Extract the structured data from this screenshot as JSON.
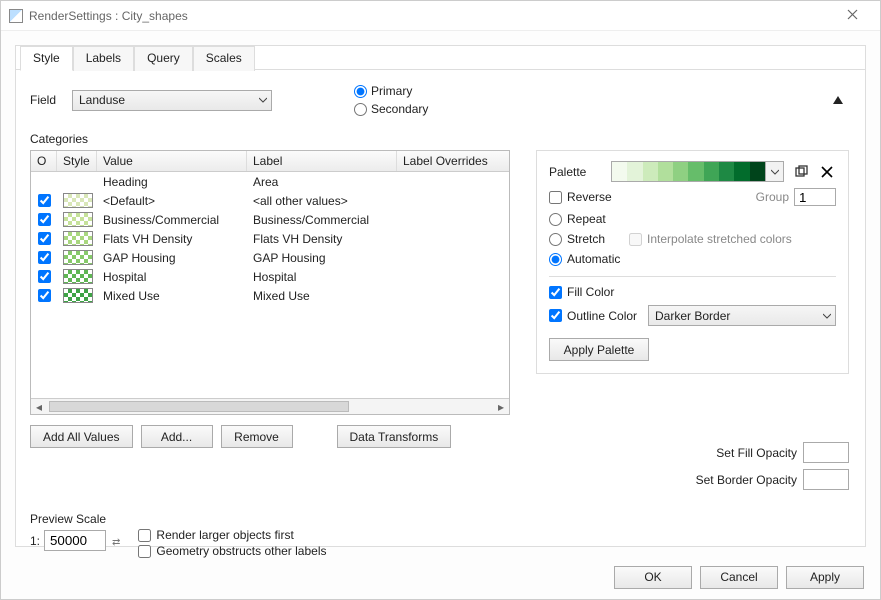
{
  "window": {
    "title": "RenderSettings : City_shapes"
  },
  "tabs": [
    "Style",
    "Labels",
    "Query",
    "Scales"
  ],
  "active_tab": 0,
  "field": {
    "label": "Field",
    "value": "Landuse"
  },
  "mode": {
    "primary": "Primary",
    "secondary": "Secondary",
    "selected": "primary"
  },
  "categories": {
    "title": "Categories",
    "columns": {
      "o": "O",
      "style": "Style",
      "value": "Value",
      "label": "Label",
      "overrides": "Label Overrides"
    },
    "heading_row": {
      "value": "Heading",
      "label": "Area"
    },
    "rows": [
      {
        "checked": true,
        "color": "#d9e7b8",
        "value": "<Default>",
        "label": "<all other values>"
      },
      {
        "checked": true,
        "color": "#c6e29a",
        "value": "Business/Commercial",
        "label": "Business/Commercial"
      },
      {
        "checked": true,
        "color": "#a9d77f",
        "value": "Flats VH Density",
        "label": "Flats VH Density"
      },
      {
        "checked": true,
        "color": "#86c96a",
        "value": "GAP Housing",
        "label": "GAP Housing"
      },
      {
        "checked": true,
        "color": "#5fb654",
        "value": "Hospital",
        "label": "Hospital"
      },
      {
        "checked": true,
        "color": "#3ea346",
        "value": "Mixed Use",
        "label": "Mixed Use"
      }
    ]
  },
  "buttons": {
    "add_all": "Add All Values",
    "add": "Add...",
    "remove": "Remove",
    "transforms": "Data Transforms"
  },
  "palette": {
    "label": "Palette",
    "colors": [
      "#f3faee",
      "#e3f3d9",
      "#cdebbb",
      "#b1df9c",
      "#8fd082",
      "#66bd6a",
      "#3fa556",
      "#1e8944",
      "#026c2c",
      "#00441b"
    ],
    "reverse_label": "Reverse",
    "reverse": false,
    "group_label": "Group",
    "group_value": "1",
    "repeat_label": "Repeat",
    "stretch_label": "Stretch",
    "interp_label": "Interpolate stretched colors",
    "auto_label": "Automatic",
    "mode": "automatic",
    "fill_label": "Fill Color",
    "fill": true,
    "outline_label": "Outline Color",
    "outline": true,
    "outline_value": "Darker Border",
    "apply_label": "Apply Palette"
  },
  "opacity": {
    "fill_label": "Set Fill Opacity",
    "border_label": "Set Border Opacity",
    "fill_value": "",
    "border_value": ""
  },
  "preview": {
    "title": "Preview Scale",
    "prefix": "1:",
    "value": "50000",
    "render_first": "Render larger objects first",
    "geom_obstruct": "Geometry obstructs other labels"
  },
  "footer": {
    "ok": "OK",
    "cancel": "Cancel",
    "apply": "Apply"
  }
}
